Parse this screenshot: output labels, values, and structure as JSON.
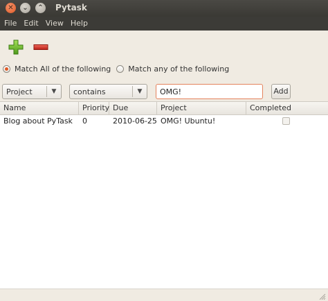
{
  "window": {
    "title": "Pytask"
  },
  "menu": {
    "items": [
      "File",
      "Edit",
      "View",
      "Help"
    ]
  },
  "toolbar": {
    "add_icon": "add-plus-icon",
    "remove_icon": "remove-minus-icon",
    "add_color": "#6fbf2b",
    "remove_color": "#d9322a"
  },
  "match": {
    "all_label": "Match All of the following",
    "any_label": "Match any of the following",
    "selected": "all"
  },
  "filter": {
    "field_value": "Project",
    "operator_value": "contains",
    "search_value": "OMG!",
    "add_label": "Add"
  },
  "table": {
    "columns": [
      "Name",
      "Priority",
      "Due",
      "Project",
      "Completed"
    ],
    "rows": [
      {
        "name": "Blog about PyTask",
        "priority": "0",
        "due": "2010-06-25",
        "project": "OMG! Ubuntu!",
        "completed": false
      }
    ]
  }
}
